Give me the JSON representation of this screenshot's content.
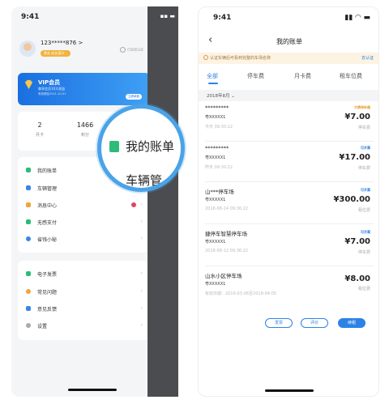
{
  "left": {
    "time": "9:41",
    "username": "123*****876 >",
    "member_badge": "黄金 成长值0/...",
    "verify_label": "已完成认证",
    "vip": {
      "title": "VIP会员",
      "subtitle": "尊享会员10大权益",
      "expiry": "有效期至2021-10-01",
      "button": "立即续费"
    },
    "stats": [
      {
        "value": "2",
        "label": "月卡"
      },
      {
        "value": "1466",
        "label": "积分"
      }
    ],
    "menu1": [
      {
        "label": "我的账单",
        "color": "#2dbb7a"
      },
      {
        "label": "车辆管理",
        "color": "#3a86e8"
      },
      {
        "label": "消息中心",
        "color": "#f2a33a"
      },
      {
        "label": "无感支付",
        "color": "#2dbb7a"
      },
      {
        "label": "省钱小秘",
        "color": "#3a86e8"
      }
    ],
    "menu2": [
      {
        "label": "电子发票",
        "color": "#2dbb7a"
      },
      {
        "label": "常见问题",
        "color": "#f2a33a"
      },
      {
        "label": "意见反馈",
        "color": "#3a86e8"
      },
      {
        "label": "设置",
        "color": "#aaaaaa"
      }
    ],
    "magnifier": {
      "line1": "我的账单",
      "line2": "车辆管"
    }
  },
  "right": {
    "time": "9:41",
    "title": "我的账单",
    "notice": "认证车辆后可看到完整的车场名称",
    "notice_link": "去认证",
    "tabs": [
      "全部",
      "停车费",
      "月卡费",
      "租车位费"
    ],
    "month": "2018年8月",
    "records": [
      {
        "name": "*********",
        "plate": "粤XXXXX1",
        "time": "今天 09:30:22",
        "status": "欠费待补缴",
        "status_color": "#e59a2e",
        "amount": "¥7.00",
        "type": "停车费"
      },
      {
        "name": "*********",
        "plate": "粤XXXXX1",
        "time": "昨天 09:30:22",
        "status": "可开票",
        "status_color": "#2d82e6",
        "amount": "¥17.00",
        "type": "停车费"
      },
      {
        "name": "山***停车场",
        "plate": "粤XXXXX1",
        "time": "2018-08-14 09:36:22",
        "status": "可开票",
        "status_color": "#2d82e6",
        "amount": "¥300.00",
        "type": "租位费"
      },
      {
        "name": "捷停车智慧停车场",
        "plate": "粤XXXXX1",
        "time": "2018-08-12 09:36:22",
        "status": "可开票",
        "status_color": "#2d82e6",
        "amount": "¥7.00",
        "type": "停车费"
      },
      {
        "name": "山水小区停车场",
        "plate": "粤XXXXX1",
        "time": "有效日期：2019-03-06至2019-04-05",
        "status": "",
        "status_color": "#2d82e6",
        "amount": "¥8.00",
        "type": "租位费"
      }
    ],
    "actions": [
      "发票",
      "评价",
      "续租"
    ]
  }
}
